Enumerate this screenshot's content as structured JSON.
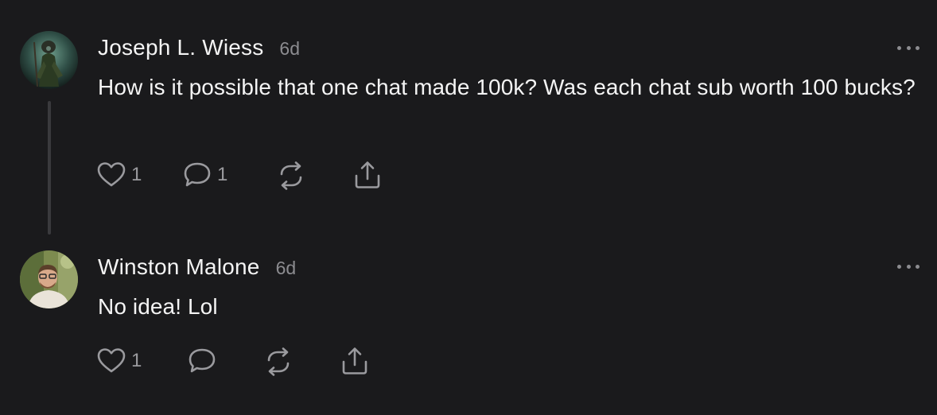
{
  "comments": [
    {
      "author": "Joseph L. Wiess",
      "time": "6d",
      "text": "How is it possible that one chat made 100k? Was each chat sub worth 100 bucks?",
      "likes": "1",
      "replies": "1"
    },
    {
      "author": "Winston Malone",
      "time": "6d",
      "text": "No idea! Lol",
      "likes": "1",
      "replies": ""
    }
  ],
  "icons": {
    "like": "heart-icon",
    "reply": "speech-bubble-icon",
    "restack": "restack-icon",
    "share": "share-icon",
    "more": "more-dots-icon"
  },
  "colors": {
    "background": "#1a1a1c",
    "text": "#f4f4f4",
    "muted": "#8c8c90",
    "thread_line": "#3a3a3d"
  }
}
